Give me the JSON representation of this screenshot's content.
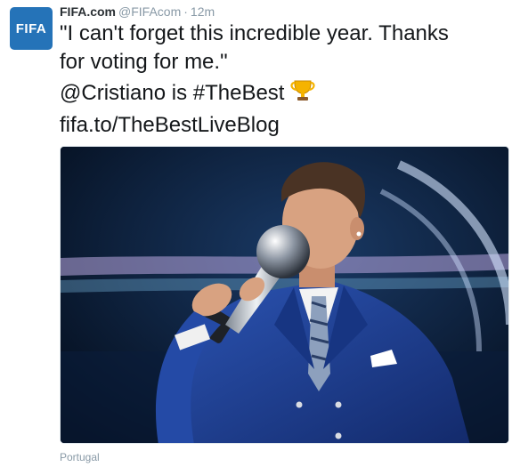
{
  "author": {
    "avatar_text": "FIFA",
    "display_name": "FIFA.com",
    "screen_name": "@FIFAcom",
    "separator": "·",
    "time": "12m"
  },
  "tweet": {
    "line1": "\"I can't forget this incredible year. Thanks",
    "line2": "for voting for me.\"",
    "mention": "@Cristiano",
    "mid_text": " is ",
    "hashtag": "#TheBest",
    "trophy_icon": "trophy-emoji",
    "link": "fifa.to/TheBestLiveBlog"
  },
  "media": {
    "photo_subject": "photo-player-kissing-trophy",
    "colors": {
      "background": "#06162a",
      "suit": "#1f3f93",
      "trophy": "#c9cfd6"
    }
  },
  "location": {
    "label": "Portugal"
  },
  "colors": {
    "brand": "#2573b8",
    "text": "#14171a",
    "muted": "#8899a6"
  }
}
